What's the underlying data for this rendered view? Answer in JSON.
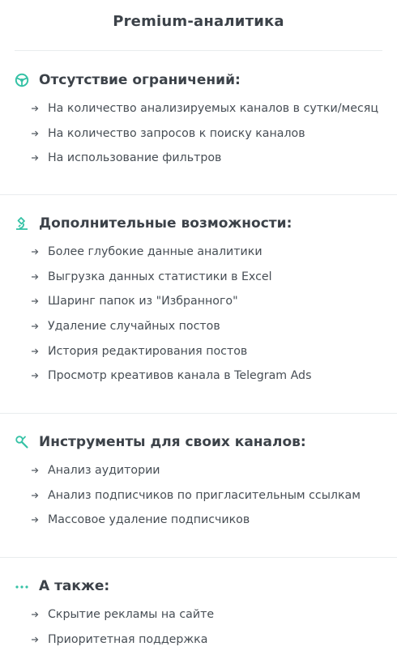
{
  "page": {
    "title": "Premium-аналитика"
  },
  "colors": {
    "accent": "#36c2a6",
    "text": "#474e55",
    "divider": "#e9ecee"
  },
  "sections": [
    {
      "icon": "steering-wheel-icon",
      "title": "Отсутствие ограничений:",
      "items": [
        "На количество анализируемых каналов в сутки/месяц",
        "На количество запросов к поиску каналов",
        "На использование фильтров"
      ]
    },
    {
      "icon": "microscope-icon",
      "title": "Дополнительные возможности:",
      "items": [
        "Более глубокие данные аналитики",
        "Выгрузка данных статистики в Excel",
        "Шаринг папок из \"Избранного\"",
        "Удаление случайных постов",
        "История редактирования постов",
        "Просмотр креативов канала в Telegram Ads"
      ]
    },
    {
      "icon": "tools-icon",
      "title": "Инструменты для своих каналов:",
      "items": [
        "Анализ аудитории",
        "Анализ подписчиков по пригласительным ссылкам",
        "Массовое удаление подписчиков"
      ]
    },
    {
      "icon": "more-dots-icon",
      "title": "А также:",
      "items": [
        "Скрытие рекламы на сайте",
        "Приоритетная поддержка"
      ]
    }
  ]
}
